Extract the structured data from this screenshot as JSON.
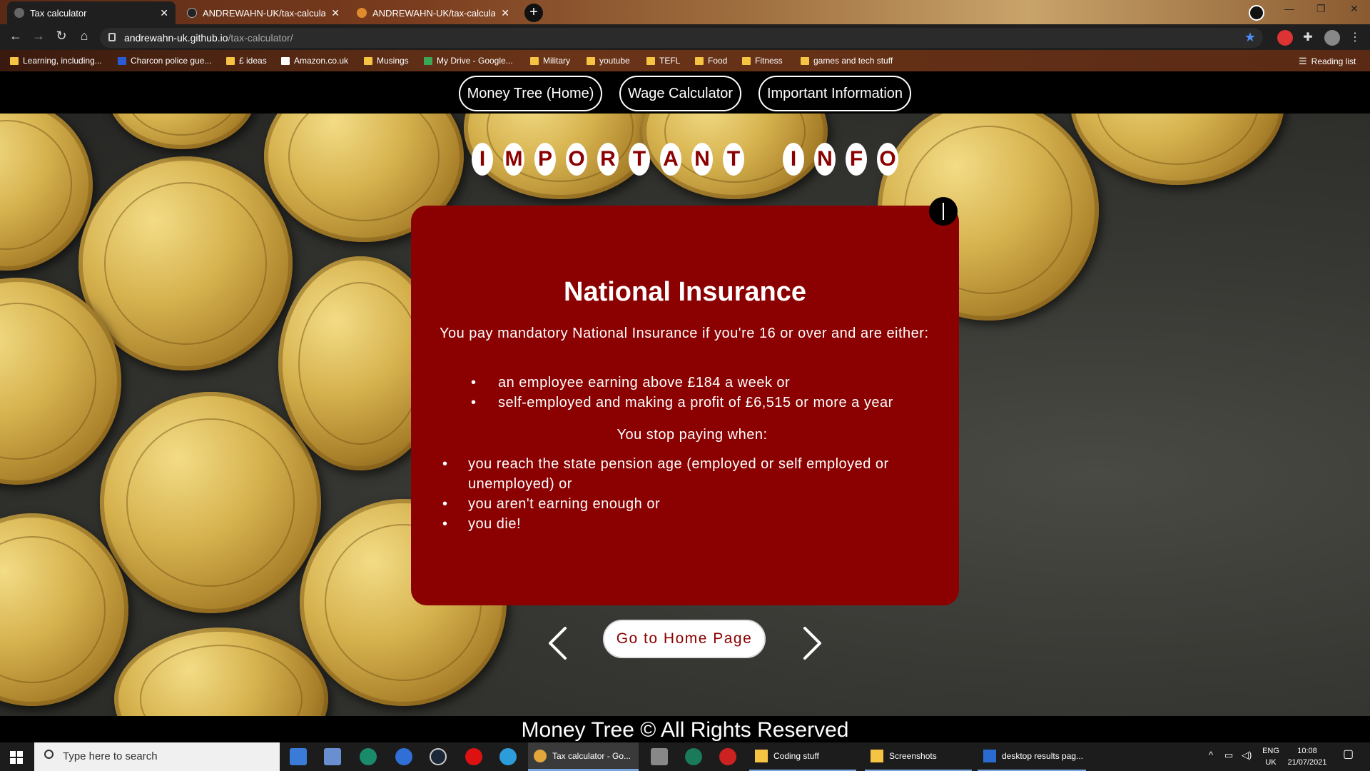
{
  "browser": {
    "tabs": [
      {
        "label": "Tax calculator",
        "close": "✕"
      },
      {
        "label": "ANDREWAHN-UK/tax-calculator",
        "close": "✕"
      },
      {
        "label": "ANDREWAHN-UK/tax-calculator",
        "close": "✕"
      }
    ],
    "new_tab": "+",
    "url_host": "andrewahn-uk.github.io",
    "url_path": "/tax-calculator/",
    "bookmarks": [
      "Learning, including...",
      "Charcon police gue...",
      "£ ideas",
      "Amazon.co.uk",
      "Musings",
      "My Drive - Google...",
      "Military",
      "youtube",
      "TEFL",
      "Food",
      "Fitness",
      "games and tech stuff"
    ],
    "reading_list": "Reading list"
  },
  "nav": {
    "home": "Money Tree (Home)",
    "wage": "Wage Calculator",
    "info": "Important Information"
  },
  "title_letters": [
    "I",
    "M",
    "P",
    "O",
    "R",
    "T",
    "A",
    "N",
    "T",
    " ",
    "I",
    "N",
    "F",
    "O"
  ],
  "card": {
    "heading": "National Insurance",
    "intro": "You pay mandatory National Insurance if you're 16 or over and are either:",
    "conditions": [
      "an employee earning above £184 a week or",
      "self-employed and making a profit of £6,515 or more a year"
    ],
    "stop_heading": "You stop paying when:",
    "stop_items": [
      "you reach the state pension age (employed or self employed or unemployed) or",
      "you aren't earning enough or",
      "you die!"
    ]
  },
  "home_button": "Go to Home Page",
  "footer": "Money Tree © All Rights Reserved",
  "taskbar": {
    "search_placeholder": "Type here to search",
    "apps": [
      {
        "label": "Tax calculator - Go..."
      },
      {
        "label": "Coding stuff"
      },
      {
        "label": "Screenshots"
      },
      {
        "label": "desktop results pag..."
      }
    ],
    "lang": "ENG",
    "region": "UK",
    "time": "10:08",
    "date": "21/07/2021"
  },
  "colors": {
    "accent": "#8b0000",
    "page_bg": "#000000",
    "button_bg": "#ffffff"
  }
}
